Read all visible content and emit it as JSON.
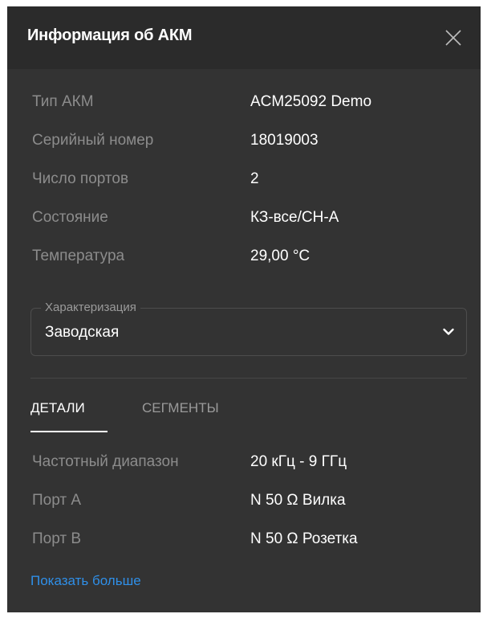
{
  "dialog": {
    "title": "Информация об АКМ"
  },
  "info": [
    {
      "label": "Тип АКМ",
      "value": "ACM25092 Demo"
    },
    {
      "label": "Серийный номер",
      "value": "18019003"
    },
    {
      "label": "Число портов",
      "value": "2"
    },
    {
      "label": "Состояние",
      "value": "КЗ-все/СН-А"
    },
    {
      "label": "Температура",
      "value": "29,00 °C"
    }
  ],
  "characterization": {
    "label": "Характеризация",
    "selected": "Заводская"
  },
  "tabs": [
    {
      "label": "ДЕТАЛИ",
      "active": true
    },
    {
      "label": "СЕГМЕНТЫ",
      "active": false
    }
  ],
  "details": [
    {
      "label": "Частотный диапазон",
      "value": "20 кГц - 9 ГГц"
    },
    {
      "label": "Порт A",
      "value": "N 50 Ω Вилка"
    },
    {
      "label": "Порт B",
      "value": "N 50 Ω Розетка"
    }
  ],
  "show_more": "Показать больше",
  "colors": {
    "panel_bg": "#333333",
    "header_bg": "#2b2b2b",
    "label_text": "#8c8c8c",
    "value_text": "#ffffff",
    "link": "#2f8fe8"
  },
  "icons": {
    "close": "close-icon",
    "dropdown": "chevron-down-icon"
  }
}
